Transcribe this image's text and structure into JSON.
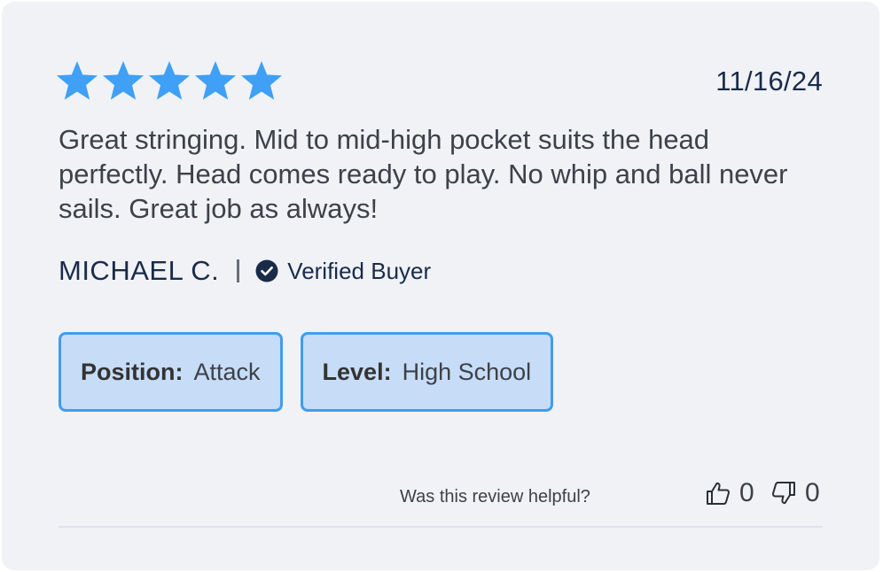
{
  "review": {
    "rating": 5,
    "rating_max": 5,
    "star_color": "#3fa0f5",
    "date": "11/16/24",
    "body": "Great stringing. Mid to mid-high pocket suits the head perfectly. Head comes ready to play. No whip and ball never sails. Great job as always!",
    "author": "MICHAEL C.",
    "verified_label": "Verified Buyer",
    "tags": [
      {
        "key": "Position:",
        "value": "Attack"
      },
      {
        "key": "Level:",
        "value": "High School"
      }
    ],
    "helpful_question": "Was this review helpful?",
    "helpful_yes_count": "0",
    "helpful_no_count": "0"
  },
  "icons": {
    "star": "star-icon",
    "verified": "check-circle-icon",
    "thumbs_up": "thumbs-up-icon",
    "thumbs_down": "thumbs-down-icon"
  },
  "colors": {
    "card_bg": "#f0f2f6",
    "tag_bg": "#c6dcf7",
    "tag_border": "#3f9df0",
    "navy": "#1a2b4a"
  }
}
